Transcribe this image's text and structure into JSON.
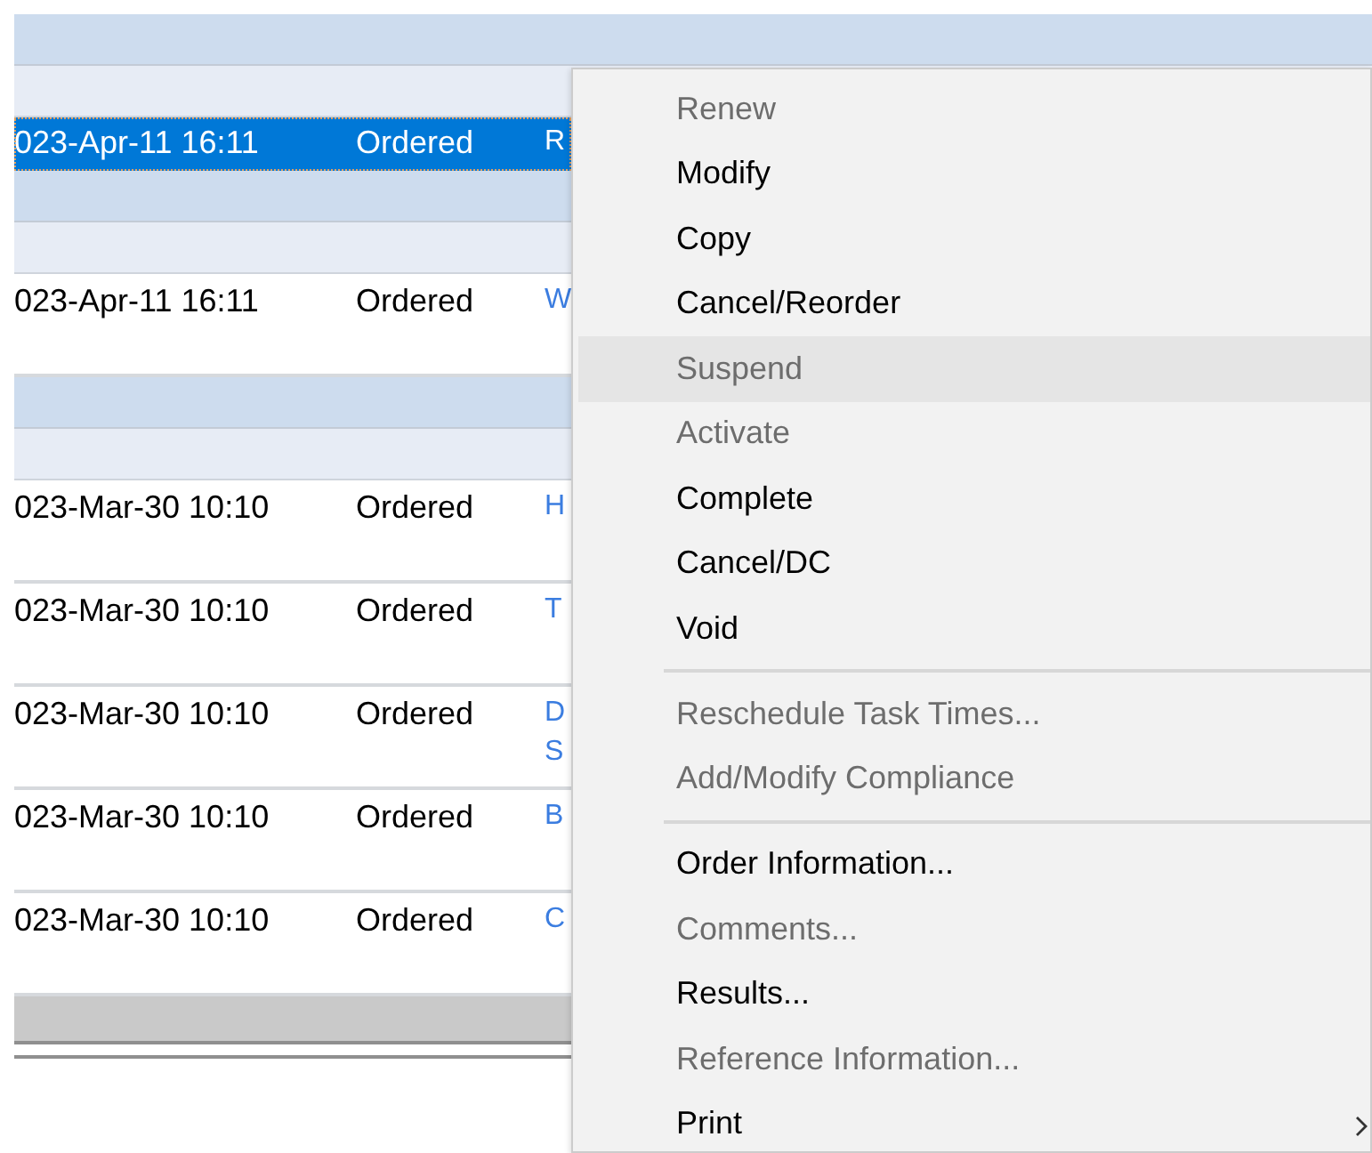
{
  "grid": {
    "rows": [
      {
        "kind": "group-header"
      },
      {
        "kind": "subheader"
      },
      {
        "kind": "order-compact",
        "date": "023-Apr-11 16:11",
        "status": "Ordered",
        "column_3": "R",
        "selected": true
      },
      {
        "kind": "group-header"
      },
      {
        "kind": "subheader"
      },
      {
        "kind": "order",
        "date": "023-Apr-11 16:11",
        "status": "Ordered",
        "column_3": "W",
        "selected": false
      },
      {
        "kind": "group-header"
      },
      {
        "kind": "subheader"
      },
      {
        "kind": "order",
        "date": "023-Mar-30 10:10",
        "status": "Ordered",
        "column_3": "H",
        "selected": false
      },
      {
        "kind": "order",
        "date": "023-Mar-30 10:10",
        "status": "Ordered",
        "column_3": "T",
        "selected": false
      },
      {
        "kind": "order",
        "date": "023-Mar-30 10:10",
        "status": "Ordered",
        "column_3": "D S",
        "selected": false
      },
      {
        "kind": "order",
        "date": "023-Mar-30 10:10",
        "status": "Ordered",
        "column_3": "B",
        "selected": false
      },
      {
        "kind": "order",
        "date": "023-Mar-30 10:10",
        "status": "Ordered",
        "column_3": "C",
        "selected": false
      }
    ]
  },
  "context_menu": {
    "items": [
      {
        "kind": "item",
        "label": "Renew",
        "disabled": true,
        "highlighted": false
      },
      {
        "kind": "item",
        "label": "Modify",
        "disabled": false,
        "highlighted": false
      },
      {
        "kind": "item",
        "label": "Copy",
        "disabled": false,
        "highlighted": false
      },
      {
        "kind": "item",
        "label": "Cancel/Reorder",
        "disabled": false,
        "highlighted": false
      },
      {
        "kind": "item",
        "label": "Suspend",
        "disabled": true,
        "highlighted": true
      },
      {
        "kind": "item",
        "label": "Activate",
        "disabled": true,
        "highlighted": false
      },
      {
        "kind": "item",
        "label": "Complete",
        "disabled": false,
        "highlighted": false
      },
      {
        "kind": "item",
        "label": "Cancel/DC",
        "disabled": false,
        "highlighted": false
      },
      {
        "kind": "item",
        "label": "Void",
        "disabled": false,
        "highlighted": false
      },
      {
        "kind": "separator"
      },
      {
        "kind": "item",
        "label": "Reschedule Task Times...",
        "disabled": true,
        "highlighted": false
      },
      {
        "kind": "item",
        "label": "Add/Modify Compliance",
        "disabled": true,
        "highlighted": false
      },
      {
        "kind": "separator"
      },
      {
        "kind": "item",
        "label": "Order Information...",
        "disabled": false,
        "highlighted": false
      },
      {
        "kind": "item",
        "label": "Comments...",
        "disabled": true,
        "highlighted": false
      },
      {
        "kind": "item",
        "label": "Results...",
        "disabled": false,
        "highlighted": false
      },
      {
        "kind": "item",
        "label": "Reference Information...",
        "disabled": true,
        "highlighted": false
      },
      {
        "kind": "submenu",
        "label": "Print",
        "disabled": false,
        "highlighted": false
      }
    ]
  }
}
